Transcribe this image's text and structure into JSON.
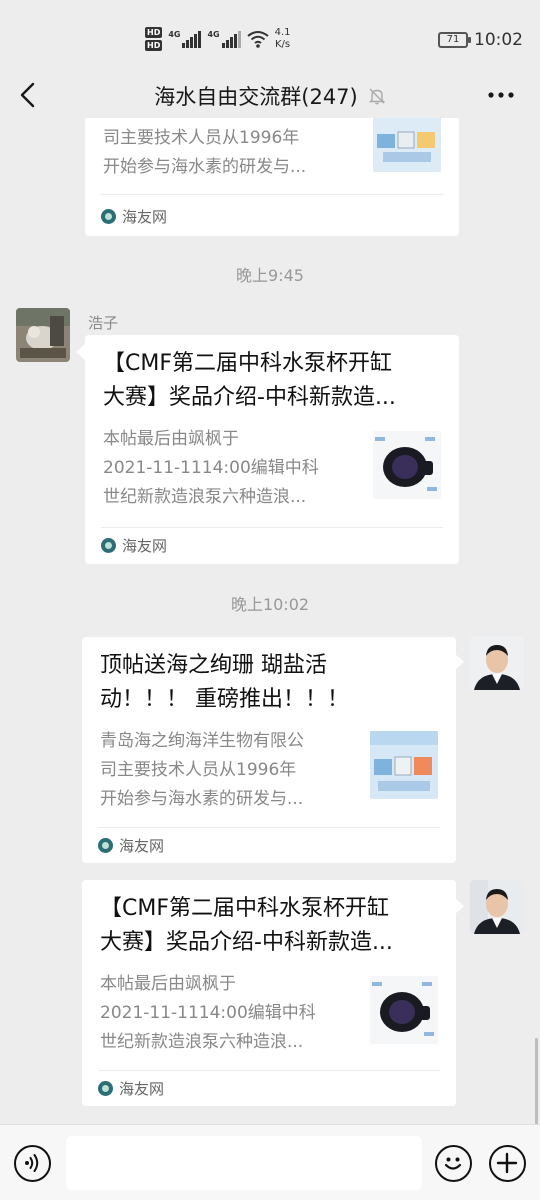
{
  "status_bar": {
    "hd_labels": [
      "HD",
      "HD"
    ],
    "net_type_1": "4G",
    "net_type_2": "4G",
    "speed_value": "4.1",
    "speed_unit": "K/s",
    "battery": "71",
    "time": "10:02"
  },
  "header": {
    "title": "海水自由交流群(247)",
    "icons": [
      "back-chevron-icon",
      "mute-bell-icon",
      "more-dots-icon"
    ]
  },
  "messages": [
    {
      "kind": "link_card",
      "side": "left",
      "partial": true,
      "desc_lines": [
        "司主要技术人员从1996年",
        "开始参与海水素的研发与..."
      ],
      "source": "海友网"
    },
    {
      "kind": "timestamp",
      "text": "晚上9:45"
    },
    {
      "kind": "link_card",
      "side": "left",
      "sender": "浩子",
      "title_lines": [
        "【CMF第二届中科水泵杯开缸",
        "大赛】奖品介绍-中科新款造..."
      ],
      "desc_lines": [
        "本帖最后由飒枫于",
        "2021-11-1114:00编辑中科",
        "世纪新款造浪泵六种造浪..."
      ],
      "source": "海友网"
    },
    {
      "kind": "timestamp",
      "text": "晚上10:02"
    },
    {
      "kind": "link_card",
      "side": "right",
      "title_lines": [
        "顶帖送海之绚珊 瑚盐活",
        "动！！！ 重磅推出！！！"
      ],
      "desc_lines": [
        "青岛海之绚海洋生物有限公",
        "司主要技术人员从1996年",
        "开始参与海水素的研发与..."
      ],
      "source": "海友网"
    },
    {
      "kind": "link_card",
      "side": "right",
      "title_lines": [
        "【CMF第二届中科水泵杯开缸",
        "大赛】奖品介绍-中科新款造..."
      ],
      "desc_lines": [
        "本帖最后由飒枫于",
        "2021-11-1114:00编辑中科",
        "世纪新款造浪泵六种造浪..."
      ],
      "source": "海友网"
    }
  ],
  "input_bar": {
    "icons": [
      "voice-icon",
      "emoji-icon",
      "plus-icon"
    ],
    "text_value": ""
  }
}
